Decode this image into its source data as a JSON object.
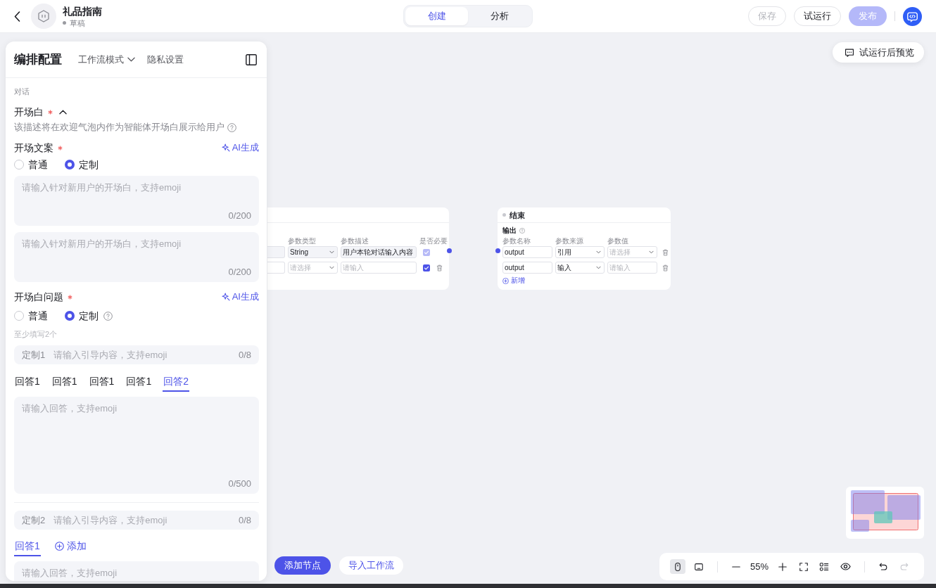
{
  "top_bar": {
    "title": "礼品指南",
    "status": "草稿",
    "mode_tabs": [
      {
        "label": "创建",
        "selected": true
      },
      {
        "label": "分析",
        "selected": false
      }
    ],
    "actions": [
      {
        "label": "保存",
        "kind": "outline",
        "disabled": true
      },
      {
        "label": "试运行",
        "kind": "outline",
        "disabled": false
      },
      {
        "label": "发布",
        "kind": "primary",
        "disabled": true
      }
    ]
  },
  "preview_button": {
    "label": "试运行后预览"
  },
  "config_panel": {
    "title": "编排配置",
    "mode_menu": "工作流模式",
    "privacy_link": "隐私设置",
    "section_label": "对话",
    "opening": {
      "label": "开场白",
      "required": true,
      "expanded": true,
      "description": "该描述将在欢迎气泡内作为智能体开场白展示给用户"
    },
    "opening_text": {
      "label": "开场文案",
      "required": true,
      "ai_button": "AI生成",
      "options": [
        {
          "label": "普通",
          "selected": false
        },
        {
          "label": "定制",
          "selected": true
        }
      ],
      "textareas": [
        {
          "placeholder": "请输入针对新用户的开场白，支持emoji",
          "counter": "0/200"
        },
        {
          "placeholder": "请输入针对新用户的开场白，支持emoji",
          "counter": "0/200"
        }
      ]
    },
    "opening_questions": {
      "label": "开场白问题",
      "required": true,
      "ai_button": "AI生成",
      "options": [
        {
          "label": "普通",
          "selected": false
        },
        {
          "label": "定制",
          "selected": true,
          "help": true
        }
      ],
      "hint": "至少填写2个",
      "questions": [
        {
          "label": "定制1",
          "placeholder": "请输入引导内容，支持emoji",
          "counter": "0/8",
          "answer_tabs": [
            {
              "label": "回答1",
              "selected": false
            },
            {
              "label": "回答1",
              "selected": false
            },
            {
              "label": "回答1",
              "selected": false
            },
            {
              "label": "回答1",
              "selected": false
            },
            {
              "label": "回答2",
              "selected": true
            }
          ],
          "answer": {
            "placeholder": "请输入回答，支持emoji",
            "counter": "0/500"
          }
        },
        {
          "label": "定制2",
          "placeholder": "请输入引导内容，支持emoji",
          "counter": "0/8",
          "answer_tabs": [
            {
              "label": "回答1",
              "selected": true
            }
          ],
          "add_label": "添加",
          "answer": {
            "placeholder": "请输入回答，支持emoji"
          }
        }
      ]
    }
  },
  "canvas": {
    "nodes": [
      {
        "kind": "start",
        "columns": [
          "参数类型",
          "参数描述",
          "是否必要"
        ],
        "rows": [
          {
            "type": {
              "kind": "select",
              "value": "String"
            },
            "description": {
              "kind": "input",
              "value": "用户本轮对话输入内容"
            },
            "required": true,
            "disabled": true
          },
          {
            "type": {
              "kind": "select",
              "placeholder": "请选择"
            },
            "description": {
              "kind": "input",
              "placeholder": "请输入"
            },
            "required": true,
            "disabled": false
          }
        ]
      },
      {
        "kind": "end",
        "title": "结束",
        "section": "输出",
        "columns": [
          "参数名称",
          "参数来源",
          "参数值"
        ],
        "rows": [
          {
            "name": {
              "kind": "input",
              "value": "output"
            },
            "source": {
              "kind": "select",
              "value": "引用"
            },
            "value": {
              "kind": "select",
              "placeholder": "请选择"
            }
          },
          {
            "name": {
              "kind": "input",
              "value": "output"
            },
            "source": {
              "kind": "select",
              "value": "输入"
            },
            "value": {
              "kind": "input",
              "placeholder": "请输入"
            }
          }
        ],
        "add_label": "新增"
      }
    ],
    "add_node_button": "添加节点",
    "import_button": "导入工作流",
    "toolbar": {
      "tools": [
        {
          "kind": "mouse",
          "selected": true
        },
        {
          "kind": "trackpad",
          "selected": false
        }
      ],
      "zoom": "55%",
      "history": [
        {
          "kind": "undo",
          "disabled": false
        },
        {
          "kind": "redo",
          "disabled": true
        }
      ]
    }
  }
}
